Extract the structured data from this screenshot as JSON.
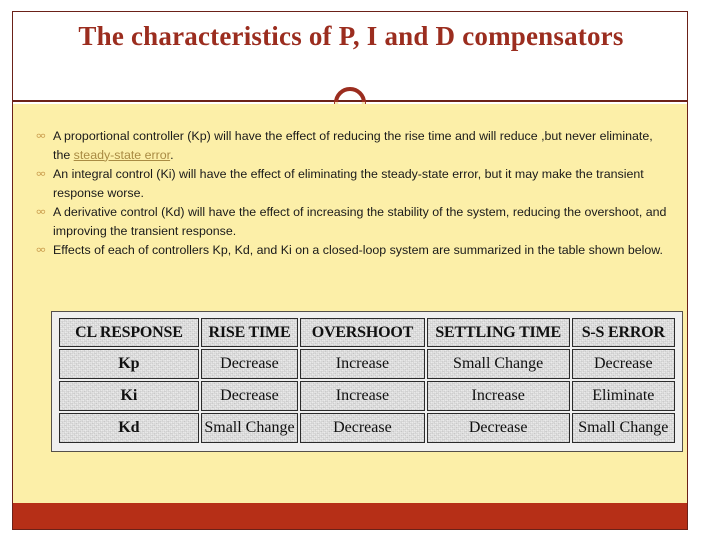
{
  "slide": {
    "title": "The characteristics of P, I and D compensators",
    "bullet_glyph": "∞",
    "colors": {
      "title_text": "#9b2d1f",
      "slide_border": "#6b2118",
      "body_background": "#fcefa8",
      "bottom_bar": "#b62f17",
      "link": "#a98b43",
      "bullet_marker": "#c89a4a"
    },
    "bullets": [
      {
        "pre": "A proportional controller (Kp) will have the effect of reducing the rise time and will reduce ,but never eliminate, the ",
        "link": "steady-state error",
        "post": "."
      },
      {
        "pre": "An integral control (Ki) will have the effect of eliminating the steady-state error, but it may make the transient response worse.",
        "link": "",
        "post": ""
      },
      {
        "pre": "A derivative control (Kd) will have the effect of increasing the stability of the system, reducing the overshoot, and improving the transient response.",
        "link": "",
        "post": ""
      },
      {
        "pre": "Effects of each of controllers Kp, Kd, and Ki on a closed-loop system are summarized in the table shown below.",
        "link": "",
        "post": ""
      }
    ],
    "table": {
      "headers": [
        "CL RESPONSE",
        "RISE TIME",
        "OVERSHOOT",
        "SETTLING TIME",
        "S-S ERROR"
      ],
      "rows": [
        [
          "Kp",
          "Decrease",
          "Increase",
          "Small Change",
          "Decrease"
        ],
        [
          "Ki",
          "Decrease",
          "Increase",
          "Increase",
          "Eliminate"
        ],
        [
          "Kd",
          "Small Change",
          "Decrease",
          "Decrease",
          "Small Change"
        ]
      ]
    }
  }
}
